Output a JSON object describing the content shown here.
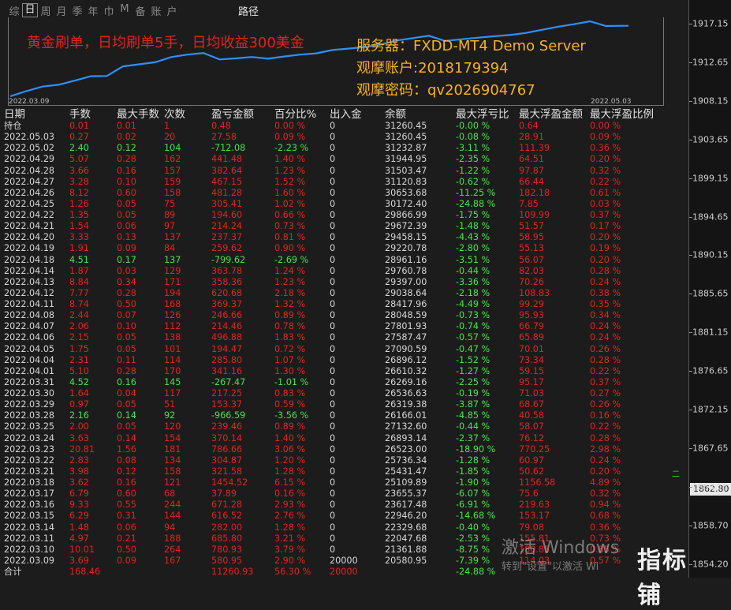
{
  "toolbar": {
    "tabs": [
      "综",
      "日",
      "周",
      "月",
      "季",
      "年",
      "巾",
      "M",
      "备",
      "账",
      "户"
    ],
    "active_index": 1,
    "path_label": "路径"
  },
  "chart": {
    "start_date": "2022.03.09",
    "end_date": "2022.05.03",
    "line_color": "#2f8fff",
    "balance_points": [
      20580.95,
      21361.88,
      22047.68,
      22329.68,
      22946.2,
      23617.48,
      23655.37,
      25109.89,
      25431.47,
      25736.34,
      26523.0,
      26893.14,
      27132.6,
      26166.01,
      26319.38,
      26536.63,
      26269.16,
      26610.32,
      26896.12,
      27090.59,
      27587.47,
      27801.93,
      28048.59,
      28417.96,
      29038.64,
      29397.0,
      29760.78,
      28961.16,
      29220.78,
      29458.15,
      29672.39,
      29866.99,
      30172.4,
      30653.68,
      31120.83,
      31503.47,
      31944.95,
      31232.87,
      31260.45
    ]
  },
  "promo_text": "黄金刷单，日均刷单5手，日均收益300美金",
  "info": {
    "server": "服务器：FXDD-MT4 Demo Server",
    "account": "观摩账户:2018179394",
    "password": "观摩密码：qv2026904767"
  },
  "price_axis": {
    "labels": [
      "1917.15",
      "1912.65",
      "1908.15",
      "1903.65",
      "1899.15",
      "1894.65",
      "1890.15",
      "1885.65",
      "1881.15",
      "1876.65",
      "1872.15",
      "1867.65",
      "1863.15",
      "1858.70",
      "1854.20"
    ],
    "current_price": "1862.80",
    "marker_text": "二"
  },
  "table": {
    "headers": [
      "日期",
      "手数",
      "最大手数",
      "次数",
      "盈亏金额",
      "百分比%",
      "出入金",
      "余额",
      "最大浮亏比",
      "最大浮盈金额",
      "最大浮盈比例"
    ],
    "rows": [
      [
        "持仓",
        "0.01",
        "0.01",
        "1",
        "0.48",
        "0.00 %",
        "0",
        "31260.45",
        "-0.00 %",
        "0.64",
        "0.00 %"
      ],
      [
        "2022.05.03",
        "0.27",
        "0.02",
        "20",
        "27.58",
        "0.09 %",
        "0",
        "31260.45",
        "-0.08 %",
        "28.91",
        "0.09 %"
      ],
      [
        "2022.05.02",
        "2.40",
        "0.12",
        "104",
        "-712.08",
        "-2.23 %",
        "0",
        "31232.87",
        "-3.11 %",
        "111.39",
        "0.36 %"
      ],
      [
        "2022.04.29",
        "5.07",
        "0.28",
        "162",
        "441.48",
        "1.40 %",
        "0",
        "31944.95",
        "-2.35 %",
        "64.51",
        "0.20 %"
      ],
      [
        "2022.04.28",
        "3.66",
        "0.16",
        "157",
        "382.64",
        "1.23 %",
        "0",
        "31503.47",
        "-1.22 %",
        "97.87",
        "0.32 %"
      ],
      [
        "2022.04.27",
        "3.28",
        "0.10",
        "159",
        "467.15",
        "1.52 %",
        "0",
        "31120.83",
        "-0.62 %",
        "66.44",
        "0.22 %"
      ],
      [
        "2022.04.26",
        "8.12",
        "0.60",
        "158",
        "481.28",
        "1.60 %",
        "0",
        "30653.68",
        "-11.25 %",
        "182.18",
        "0.61 %"
      ],
      [
        "2022.04.25",
        "1.26",
        "0.05",
        "75",
        "305.41",
        "1.02 %",
        "0",
        "30172.40",
        "-24.88 %",
        "7.85",
        "0.03 %"
      ],
      [
        "2022.04.22",
        "1.35",
        "0.05",
        "89",
        "194.60",
        "0.66 %",
        "0",
        "29866.99",
        "-1.75 %",
        "109.99",
        "0.37 %"
      ],
      [
        "2022.04.21",
        "1.54",
        "0.06",
        "97",
        "214.24",
        "0.73 %",
        "0",
        "29672.39",
        "-1.48 %",
        "51.57",
        "0.17 %"
      ],
      [
        "2022.04.20",
        "3.33",
        "0.13",
        "137",
        "237.37",
        "0.81 %",
        "0",
        "29458.15",
        "-4.43 %",
        "58.95",
        "0.20 %"
      ],
      [
        "2022.04.19",
        "1.91",
        "0.09",
        "84",
        "259.62",
        "0.90 %",
        "0",
        "29220.78",
        "-2.80 %",
        "55.13",
        "0.19 %"
      ],
      [
        "2022.04.18",
        "4.51",
        "0.17",
        "137",
        "-799.62",
        "-2.69 %",
        "0",
        "28961.16",
        "-3.51 %",
        "56.07",
        "0.20 %"
      ],
      [
        "2022.04.14",
        "1.87",
        "0.03",
        "129",
        "363.78",
        "1.24 %",
        "0",
        "29760.78",
        "-0.44 %",
        "82.03",
        "0.28 %"
      ],
      [
        "2022.04.13",
        "8.84",
        "0.34",
        "171",
        "358.36",
        "1.23 %",
        "0",
        "29397.00",
        "-3.36 %",
        "70.26",
        "0.24 %"
      ],
      [
        "2022.04.12",
        "7.77",
        "0.28",
        "194",
        "620.68",
        "2.18 %",
        "0",
        "29038.64",
        "-2.18 %",
        "108.83",
        "0.38 %"
      ],
      [
        "2022.04.11",
        "8.74",
        "0.50",
        "168",
        "369.37",
        "1.32 %",
        "0",
        "28417.96",
        "-4.49 %",
        "99.29",
        "0.35 %"
      ],
      [
        "2022.04.08",
        "2.44",
        "0.07",
        "126",
        "246.66",
        "0.89 %",
        "0",
        "28048.59",
        "-0.73 %",
        "95.93",
        "0.34 %"
      ],
      [
        "2022.04.07",
        "2.06",
        "0.10",
        "112",
        "214.46",
        "0.78 %",
        "0",
        "27801.93",
        "-0.74 %",
        "66.79",
        "0.24 %"
      ],
      [
        "2022.04.06",
        "2.15",
        "0.05",
        "138",
        "496.88",
        "1.83 %",
        "0",
        "27587.47",
        "-0.57 %",
        "65.89",
        "0.24 %"
      ],
      [
        "2022.04.05",
        "1.75",
        "0.05",
        "101",
        "194.47",
        "0.72 %",
        "0",
        "27090.59",
        "-0.47 %",
        "70.01",
        "0.26 %"
      ],
      [
        "2022.04.04",
        "2.31",
        "0.11",
        "114",
        "285.80",
        "1.07 %",
        "0",
        "26896.12",
        "-1.52 %",
        "73.34",
        "0.28 %"
      ],
      [
        "2022.04.01",
        "5.10",
        "0.28",
        "170",
        "341.16",
        "1.30 %",
        "0",
        "26610.32",
        "-1.27 %",
        "59.15",
        "0.22 %"
      ],
      [
        "2022.03.31",
        "4.52",
        "0.16",
        "145",
        "-267.47",
        "-1.01 %",
        "0",
        "26269.16",
        "-2.25 %",
        "95.17",
        "0.37 %"
      ],
      [
        "2022.03.30",
        "1.64",
        "0.04",
        "117",
        "217.25",
        "0.83 %",
        "0",
        "26536.63",
        "-0.19 %",
        "71.03",
        "0.27 %"
      ],
      [
        "2022.03.29",
        "0.97",
        "0.05",
        "51",
        "153.37",
        "0.59 %",
        "0",
        "26319.38",
        "-3.87 %",
        "68.67",
        "0.26 %"
      ],
      [
        "2022.03.28",
        "2.16",
        "0.14",
        "92",
        "-966.59",
        "-3.56 %",
        "0",
        "26166.01",
        "-4.85 %",
        "40.58",
        "0.16 %"
      ],
      [
        "2022.03.25",
        "2.00",
        "0.05",
        "120",
        "239.46",
        "0.89 %",
        "0",
        "27132.60",
        "-0.44 %",
        "58.07",
        "0.22 %"
      ],
      [
        "2022.03.24",
        "3.63",
        "0.14",
        "154",
        "370.14",
        "1.40 %",
        "0",
        "26893.14",
        "-2.37 %",
        "76.12",
        "0.28 %"
      ],
      [
        "2022.03.23",
        "20.81",
        "1.56",
        "181",
        "786.66",
        "3.06 %",
        "0",
        "26523.00",
        "-18.90 %",
        "770.25",
        "2.98 %"
      ],
      [
        "2022.03.22",
        "2.83",
        "0.08",
        "134",
        "304.87",
        "1.20 %",
        "0",
        "25736.34",
        "-1.28 %",
        "60.97",
        "0.24 %"
      ],
      [
        "2022.03.21",
        "3.98",
        "0.12",
        "158",
        "321.58",
        "1.28 %",
        "0",
        "25431.47",
        "-1.85 %",
        "50.62",
        "0.20 %"
      ],
      [
        "2022.03.18",
        "3.62",
        "0.16",
        "121",
        "1454.52",
        "6.15 %",
        "0",
        "25109.89",
        "-1.90 %",
        "1156.58",
        "4.89 %"
      ],
      [
        "2022.03.17",
        "6.79",
        "0.60",
        "68",
        "37.89",
        "0.16 %",
        "0",
        "23655.37",
        "-6.07 %",
        "75.6",
        "0.32 %"
      ],
      [
        "2022.03.16",
        "9.33",
        "0.55",
        "244",
        "671.28",
        "2.93 %",
        "0",
        "23617.48",
        "-6.91 %",
        "219.63",
        "0.94 %"
      ],
      [
        "2022.03.15",
        "6.29",
        "0.31",
        "144",
        "616.52",
        "2.76 %",
        "0",
        "22946.20",
        "-14.68 %",
        "153.17",
        "0.68 %"
      ],
      [
        "2022.03.14",
        "1.48",
        "0.06",
        "94",
        "282.00",
        "1.28 %",
        "0",
        "22329.68",
        "-0.40 %",
        "79.08",
        "0.36 %"
      ],
      [
        "2022.03.11",
        "4.97",
        "0.21",
        "188",
        "685.80",
        "3.21 %",
        "0",
        "22047.68",
        "-2.53 %",
        "155.81",
        "0.73 %"
      ],
      [
        "2022.03.10",
        "10.01",
        "0.50",
        "264",
        "780.93",
        "3.79 %",
        "0",
        "21361.88",
        "-8.75 %",
        "180.85",
        "0.85 %"
      ],
      [
        "2022.03.09",
        "3.69",
        "0.09",
        "167",
        "580.95",
        "2.90 %",
        "20000",
        "20580.95",
        "-7.39 %",
        "114.03",
        "0.57 %"
      ]
    ],
    "total": [
      "合计",
      "168.46",
      "",
      "",
      "11260.93",
      "56.30 %",
      "20000",
      "",
      "-24.88 %",
      "",
      ""
    ]
  },
  "watermark": {
    "line1": "激活 Windows",
    "line2": "转到\"设置\"以激活 Wi"
  },
  "logo_text": "指标铺",
  "colors": {
    "positive": "#e3241e",
    "negative": "#4ae24a",
    "promo": "#e2241c",
    "info": "#f7b21a",
    "background": "#1c1c1c"
  }
}
